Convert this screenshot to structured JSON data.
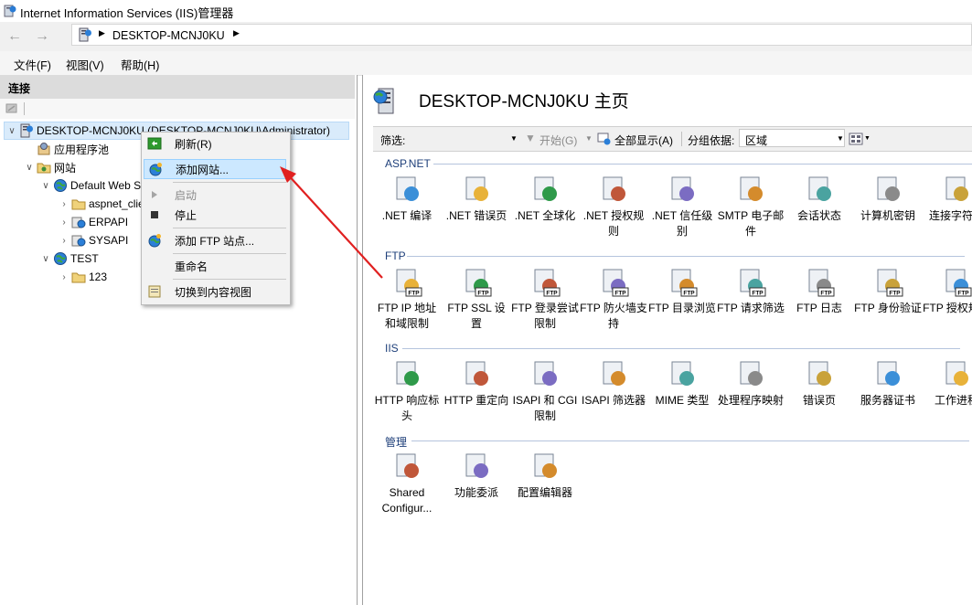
{
  "window": {
    "title": "Internet Information Services (IIS)管理器"
  },
  "address": {
    "crumb": "DESKTOP-MCNJ0KU"
  },
  "menu": [
    "文件(F)",
    "视图(V)",
    "帮助(H)"
  ],
  "connections": {
    "header": "连接",
    "tree": [
      {
        "label": "DESKTOP-MCNJ0KU (DESKTOP-MCNJ0KU\\Administrator)",
        "icon": "server-icon"
      },
      {
        "label": "应用程序池",
        "icon": "app-pool-icon"
      },
      {
        "label": "网站",
        "icon": "sites-folder-icon"
      },
      {
        "label": "Default Web Site",
        "icon": "globe-icon"
      },
      {
        "label": "aspnet_client",
        "icon": "folder-icon"
      },
      {
        "label": "ERPAPI",
        "icon": "web-app-icon"
      },
      {
        "label": "SYSAPI",
        "icon": "web-app-icon"
      },
      {
        "label": "TEST",
        "icon": "globe-icon"
      },
      {
        "label": "123",
        "icon": "folder-icon"
      }
    ]
  },
  "context_menu": [
    {
      "label": "刷新(R)",
      "icon": "refresh-icon"
    },
    {
      "label": "添加网站...",
      "icon": "add-site-icon"
    },
    {
      "label": "启动",
      "icon": "start-icon"
    },
    {
      "label": "停止",
      "icon": "stop-icon"
    },
    {
      "label": "添加 FTP 站点...",
      "icon": "add-ftp-site-icon"
    },
    {
      "label": "重命名",
      "icon": ""
    },
    {
      "label": "切换到内容视图",
      "icon": "content-view-icon"
    }
  ],
  "home": {
    "title": "DESKTOP-MCNJ0KU 主页"
  },
  "filter": {
    "label": "筛选:",
    "go": "开始(G)",
    "show_all": "全部显示(A)",
    "group_by_label": "分组依据:",
    "group_by_value": "区域"
  },
  "groups": [
    {
      "name": "ASP.NET",
      "items": [
        ".NET 编译",
        ".NET 错误页",
        ".NET 全球化",
        ".NET 授权规则",
        ".NET 信任级别",
        "SMTP 电子邮件",
        "会话状态",
        "计算机密钥",
        "连接字符串"
      ]
    },
    {
      "name": "FTP",
      "items": [
        "FTP IP 地址和域限制",
        "FTP SSL 设置",
        "FTP 登录尝试限制",
        "FTP 防火墙支持",
        "FTP 目录浏览",
        "FTP 请求筛选",
        "FTP 日志",
        "FTP 身份验证",
        "FTP 授权规则"
      ]
    },
    {
      "name": "IIS",
      "items": [
        "HTTP 响应标头",
        "HTTP 重定向",
        "ISAPI 和 CGI 限制",
        "ISAPI 筛选器",
        "MIME 类型",
        "处理程序映射",
        "错误页",
        "服务器证书",
        "工作进程"
      ]
    },
    {
      "name": "管理",
      "items": [
        "Shared Configur...",
        "功能委派",
        "配置编辑器"
      ]
    }
  ],
  "colors": {
    "accent": "#0078d7",
    "highlight": "#cce8ff",
    "arrow": "#e02020"
  }
}
